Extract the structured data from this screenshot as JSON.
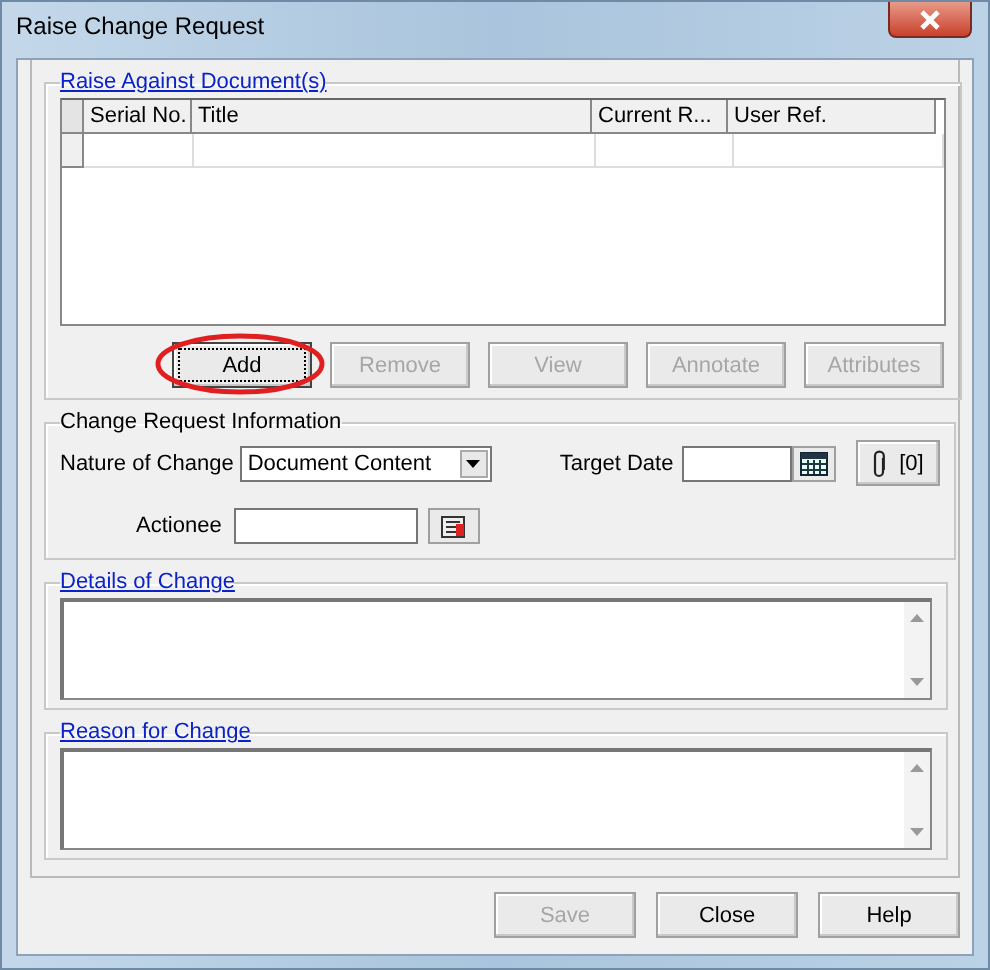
{
  "window": {
    "title": "Raise Change Request"
  },
  "documents": {
    "legend": "Raise Against Document(s)",
    "columns": [
      "Serial No.",
      "Title",
      "Current R...",
      "User Ref."
    ],
    "buttons": [
      {
        "label": "Add",
        "disabled": false,
        "highlighted": true
      },
      {
        "label": "Remove",
        "disabled": true,
        "highlighted": false
      },
      {
        "label": "View",
        "disabled": true,
        "highlighted": false
      },
      {
        "label": "Annotate",
        "disabled": true,
        "highlighted": false
      },
      {
        "label": "Attributes",
        "disabled": true,
        "highlighted": false
      }
    ]
  },
  "info": {
    "legend": "Change Request Information",
    "nature_label": "Nature of Change",
    "nature_value": "Document Content",
    "target_label": "Target Date",
    "attachments": "[0]",
    "actionee_label": "Actionee"
  },
  "details": {
    "legend": "Details of Change"
  },
  "reason": {
    "legend": "Reason for Change"
  },
  "footer": [
    {
      "label": "Save",
      "disabled": true
    },
    {
      "label": "Close",
      "disabled": false
    },
    {
      "label": "Help",
      "disabled": false
    }
  ]
}
